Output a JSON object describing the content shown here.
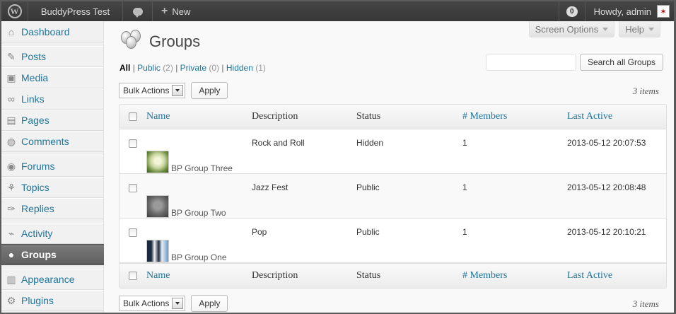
{
  "adminbar": {
    "site_name": "BuddyPress Test",
    "new_label": "New",
    "notification_count": "0",
    "howdy": "Howdy, admin"
  },
  "sidebar": {
    "items": [
      {
        "label": "Dashboard",
        "icon": "dashboard-icon"
      },
      {
        "label": "Posts",
        "icon": "pin-icon"
      },
      {
        "label": "Media",
        "icon": "media-icon"
      },
      {
        "label": "Links",
        "icon": "link-icon"
      },
      {
        "label": "Pages",
        "icon": "pages-icon"
      },
      {
        "label": "Comments",
        "icon": "comments-icon"
      },
      {
        "label": "Forums",
        "icon": "forums-icon"
      },
      {
        "label": "Topics",
        "icon": "topics-icon"
      },
      {
        "label": "Replies",
        "icon": "replies-icon"
      },
      {
        "label": "Activity",
        "icon": "activity-icon"
      },
      {
        "label": "Groups",
        "icon": "groups-icon"
      },
      {
        "label": "Appearance",
        "icon": "appearance-icon"
      },
      {
        "label": "Plugins",
        "icon": "plugins-icon"
      }
    ]
  },
  "screen_meta": {
    "screen_options": "Screen Options",
    "help": "Help"
  },
  "page": {
    "title": "Groups"
  },
  "filters": {
    "all": "All",
    "public": "Public",
    "public_count": "(2)",
    "private": "Private",
    "private_count": "(0)",
    "hidden": "Hidden",
    "hidden_count": "(1)",
    "sep": "|"
  },
  "search": {
    "value": "",
    "button": "Search all Groups"
  },
  "tablenav": {
    "bulk_actions": "Bulk Actions",
    "apply": "Apply",
    "items": "3 items"
  },
  "table": {
    "headers": {
      "name": "Name",
      "description": "Description",
      "status": "Status",
      "members": "# Members",
      "last_active": "Last Active"
    },
    "rows": [
      {
        "name": "BP Group Three",
        "description": "Rock and Roll",
        "status": "Hidden",
        "members": "1",
        "last_active": "2013-05-12 20:07:53",
        "thumb": "flower"
      },
      {
        "name": "BP Group Two",
        "description": "Jazz Fest",
        "status": "Public",
        "members": "1",
        "last_active": "2013-05-12 20:08:48",
        "thumb": "koala"
      },
      {
        "name": "BP Group One",
        "description": "Pop",
        "status": "Public",
        "members": "1",
        "last_active": "2013-05-12 20:10:21",
        "thumb": "penguin"
      }
    ]
  }
}
